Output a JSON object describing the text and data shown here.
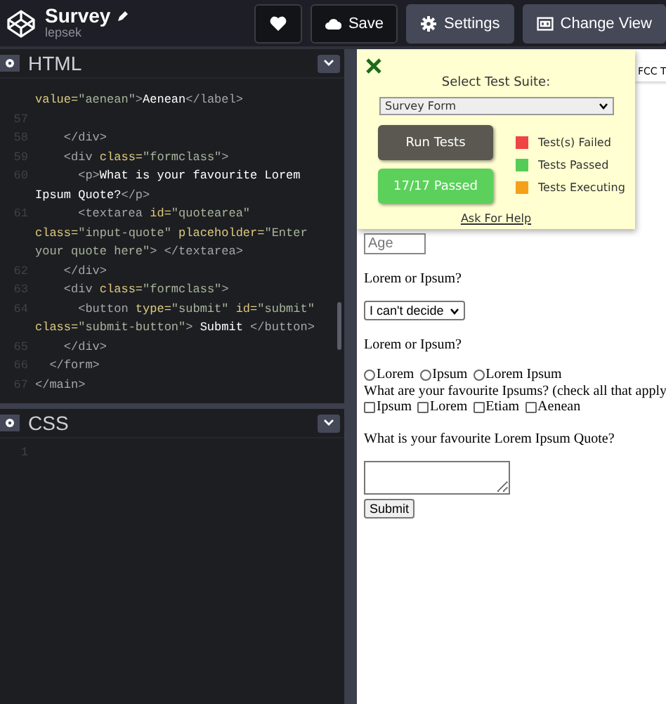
{
  "header": {
    "title": "Survey",
    "author": "lepsek",
    "buttons": [
      {
        "kind": "heart"
      },
      {
        "kind": "save",
        "label": "Save"
      },
      {
        "kind": "settings",
        "label": "Settings"
      },
      {
        "kind": "view",
        "label": "Change View"
      }
    ]
  },
  "editors": [
    {
      "title": "HTML",
      "lines": [
        {
          "segments": [
            {
              "kind": "attr",
              "text": "value="
            },
            {
              "kind": "str",
              "text": "\"aenean\""
            },
            {
              "kind": "tag",
              "text": ">"
            },
            {
              "kind": "text",
              "text": "Aenean"
            },
            {
              "kind": "tag",
              "text": "</label>"
            }
          ]
        },
        {
          "number": "57"
        },
        {
          "number": "58",
          "segments": [
            {
              "kind": "tag",
              "text": "    </div>"
            }
          ]
        },
        {
          "number": "59",
          "segments": [
            {
              "kind": "tag",
              "text": "    <div"
            },
            {
              "kind": "attr",
              "text": " class="
            },
            {
              "kind": "str",
              "text": "\"formclass\""
            },
            {
              "kind": "tag",
              "text": ">"
            }
          ]
        },
        {
          "number": "60",
          "segments": [
            {
              "kind": "tag",
              "text": "      <p>"
            },
            {
              "kind": "text",
              "text": "What is your favourite Lorem"
            }
          ]
        },
        {
          "segments": [
            {
              "kind": "text",
              "text": "Ipsum Quote?"
            },
            {
              "kind": "tag",
              "text": "</p>"
            }
          ]
        },
        {
          "number": "61",
          "segments": [
            {
              "kind": "tag",
              "text": "      <textarea"
            },
            {
              "kind": "attr",
              "text": " id="
            },
            {
              "kind": "str",
              "text": "\"quotearea\""
            }
          ]
        },
        {
          "segments": [
            {
              "kind": "attr",
              "text": "class="
            },
            {
              "kind": "str",
              "text": "\"input-quote\""
            },
            {
              "kind": "attr",
              "text": " placeholder="
            },
            {
              "kind": "str",
              "text": "\"Enter"
            }
          ]
        },
        {
          "segments": [
            {
              "kind": "str",
              "text": "your quote here\""
            },
            {
              "kind": "tag",
              "text": "> </textarea>"
            }
          ]
        },
        {
          "number": "62",
          "segments": [
            {
              "kind": "tag",
              "text": "    </div>"
            }
          ]
        },
        {
          "number": "63",
          "segments": [
            {
              "kind": "tag",
              "text": "    <div"
            },
            {
              "kind": "attr",
              "text": " class="
            },
            {
              "kind": "str",
              "text": "\"formclass\""
            },
            {
              "kind": "tag",
              "text": ">"
            }
          ]
        },
        {
          "number": "64",
          "segments": [
            {
              "kind": "tag",
              "text": "      <button"
            },
            {
              "kind": "attr",
              "text": " type="
            },
            {
              "kind": "str",
              "text": "\"submit\""
            },
            {
              "kind": "attr",
              "text": " id="
            },
            {
              "kind": "str",
              "text": "\"submit\""
            }
          ]
        },
        {
          "segments": [
            {
              "kind": "attr",
              "text": "class="
            },
            {
              "kind": "str",
              "text": "\"submit-button\""
            },
            {
              "kind": "tag",
              "text": ">"
            },
            {
              "kind": "text",
              "text": " Submit "
            },
            {
              "kind": "tag",
              "text": "</button>"
            }
          ]
        },
        {
          "number": "65",
          "segments": [
            {
              "kind": "tag",
              "text": "    </div>"
            }
          ]
        },
        {
          "number": "66",
          "segments": [
            {
              "kind": "tag",
              "text": "  </form>"
            }
          ]
        },
        {
          "number": "67",
          "segments": [
            {
              "kind": "tag",
              "text": "</main>"
            }
          ]
        }
      ]
    },
    {
      "title": "CSS",
      "lines": [
        {
          "number": "1"
        }
      ]
    }
  ],
  "preview": {
    "form": [
      {
        "kind": "input",
        "placeholder": "Age"
      },
      {
        "kind": "question",
        "text": "Lorem or Ipsum?"
      },
      {
        "kind": "select",
        "value": "I can't decide"
      },
      {
        "kind": "question",
        "text": "Lorem or Ipsum?"
      },
      {
        "kind": "radios",
        "options": [
          {
            "label": "Lorem",
            "selected": false
          },
          {
            "label": "Ipsum",
            "selected": false
          },
          {
            "label": "Lorem Ipsum",
            "selected": false
          }
        ]
      },
      {
        "kind": "label",
        "text": "What are your favourite Ipsums? (check all that apply"
      },
      {
        "kind": "checks",
        "options": [
          {
            "label": "Ipsum",
            "checked": false
          },
          {
            "label": "Lorem",
            "checked": false
          },
          {
            "label": "Etiam",
            "checked": false
          },
          {
            "label": "Aenean",
            "checked": false
          }
        ]
      },
      {
        "kind": "question",
        "text": "What is your favourite Lorem Ipsum Quote?"
      },
      {
        "kind": "textarea"
      },
      {
        "kind": "submit",
        "label": "Submit"
      }
    ],
    "test_panel": {
      "title": "Select Test Suite:",
      "suite": "Survey Form",
      "run_label": "Run Tests",
      "result": "17/17 Passed",
      "help": "Ask For Help",
      "tab": "FCC T",
      "legend": [
        {
          "label": "Test(s) Failed",
          "color": "#ee4444"
        },
        {
          "label": "Tests Passed",
          "color": "#55cc55"
        },
        {
          "label": "Tests Executing",
          "color": "#f5a01a"
        }
      ]
    }
  }
}
